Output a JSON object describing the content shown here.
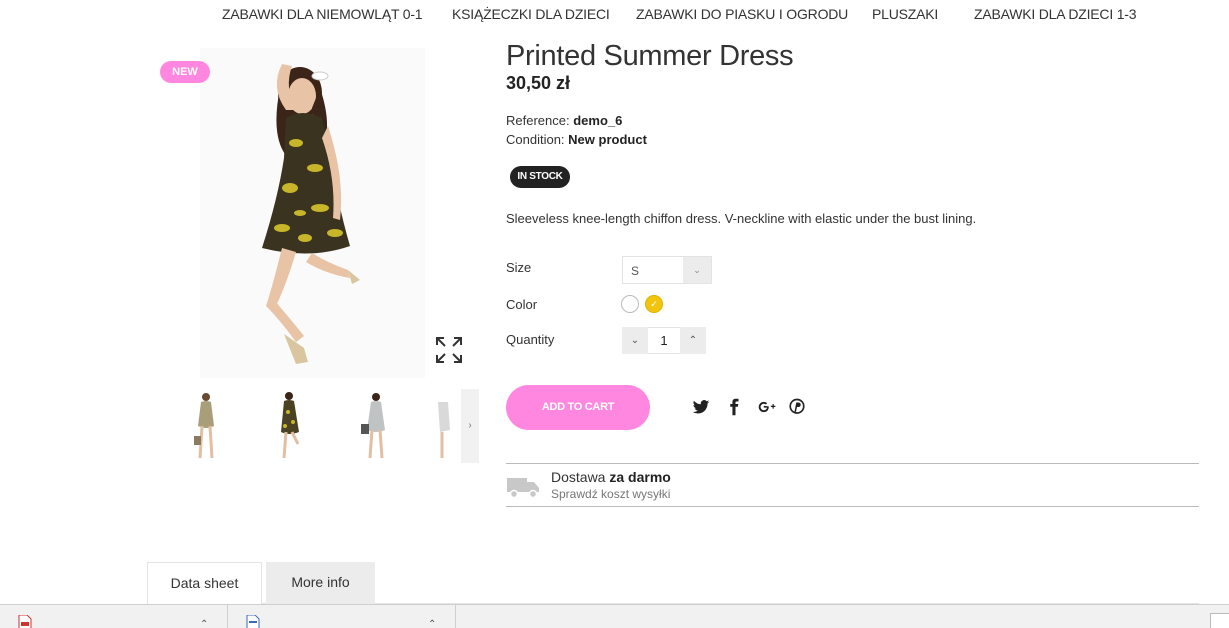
{
  "nav": {
    "items": [
      "ZABAWKI DLA NIEMOWLĄT 0-1",
      "KSIĄŻECZKI DLA DZIECI",
      "ZABAWKI DO PIASKU I OGRODU",
      "PLUSZAKI",
      "ZABAWKI DLA DZIECI 1-3"
    ]
  },
  "product": {
    "badge": "NEW",
    "title": "Printed Summer Dress",
    "price": "30,50 zł",
    "reference_label": "Reference:",
    "reference_value": "demo_6",
    "condition_label": "Condition:",
    "condition_value": "New product",
    "stock": "IN STOCK",
    "description": "Sleeveless knee-length chiffon dress. V-neckline with elastic under the bust lining.",
    "size_label": "Size",
    "size_value": "S",
    "color_label": "Color",
    "colors": [
      "#ffffff",
      "#f1c40f"
    ],
    "selected_color": "#f1c40f",
    "quantity_label": "Quantity",
    "quantity_value": "1",
    "add_to_cart": "ADD TO CART"
  },
  "shipping": {
    "title_prefix": "Dostawa",
    "title_bold": "za darmo",
    "subtitle": "Sprawdź koszt wysyłki"
  },
  "tabs": [
    "Data sheet",
    "More info"
  ],
  "social": [
    "twitter-icon",
    "facebook-icon",
    "google-plus-icon",
    "pinterest-icon"
  ],
  "colors": {
    "accent": "#ff87e0",
    "dark": "#222222",
    "tab_inactive": "#ececec"
  }
}
